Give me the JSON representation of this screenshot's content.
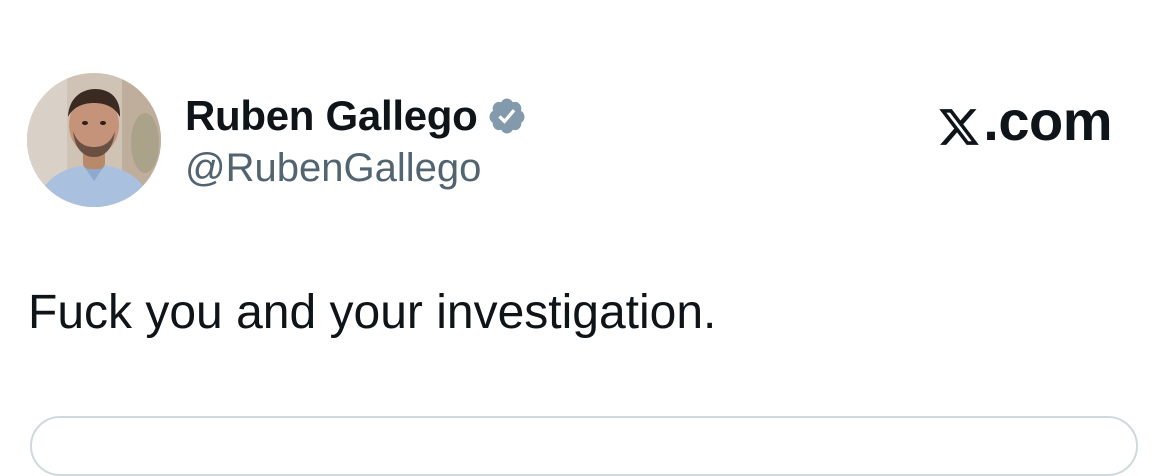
{
  "tweet": {
    "display_name": "Ruben Gallego",
    "handle": "@RubenGallego",
    "verified": true,
    "text": "Fuck you and your investigation."
  },
  "brand": {
    "label": ".com"
  },
  "icons": {
    "avatar": "profile-photo",
    "verified": "verified-badge-icon",
    "brand": "x-logo-icon"
  },
  "colors": {
    "text_primary": "#0f1419",
    "text_secondary": "#536471",
    "verified_badge": "#829aab",
    "card_border": "#cfd9de"
  }
}
